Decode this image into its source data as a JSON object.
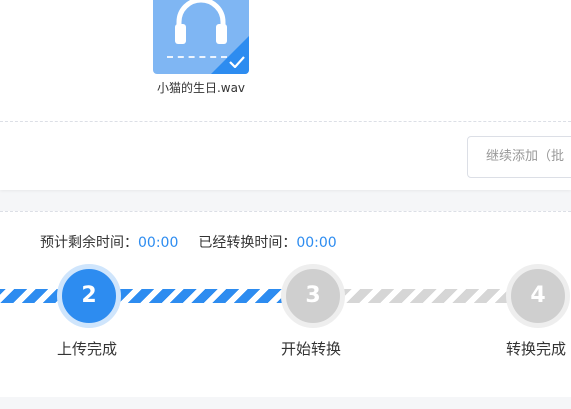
{
  "file": {
    "name": "小猫的生日.wav",
    "icon": "headphone-icon",
    "selected_icon": "check-icon",
    "tile_color": "#7fb6f3"
  },
  "toolbar": {
    "continue_add_label": "继续添加（批"
  },
  "timing": {
    "remaining_label": "预计剩余时间：",
    "remaining_value": "00:00",
    "elapsed_label": "已经转换时间：",
    "elapsed_value": "00:00"
  },
  "steps": [
    {
      "number": "2",
      "label": "上传完成",
      "state": "active"
    },
    {
      "number": "3",
      "label": "开始转换",
      "state": "pending"
    },
    {
      "number": "4",
      "label": "转换完成",
      "state": "pending"
    }
  ],
  "colors": {
    "accent": "#2d8cf0",
    "pending": "#cfcfcf"
  }
}
